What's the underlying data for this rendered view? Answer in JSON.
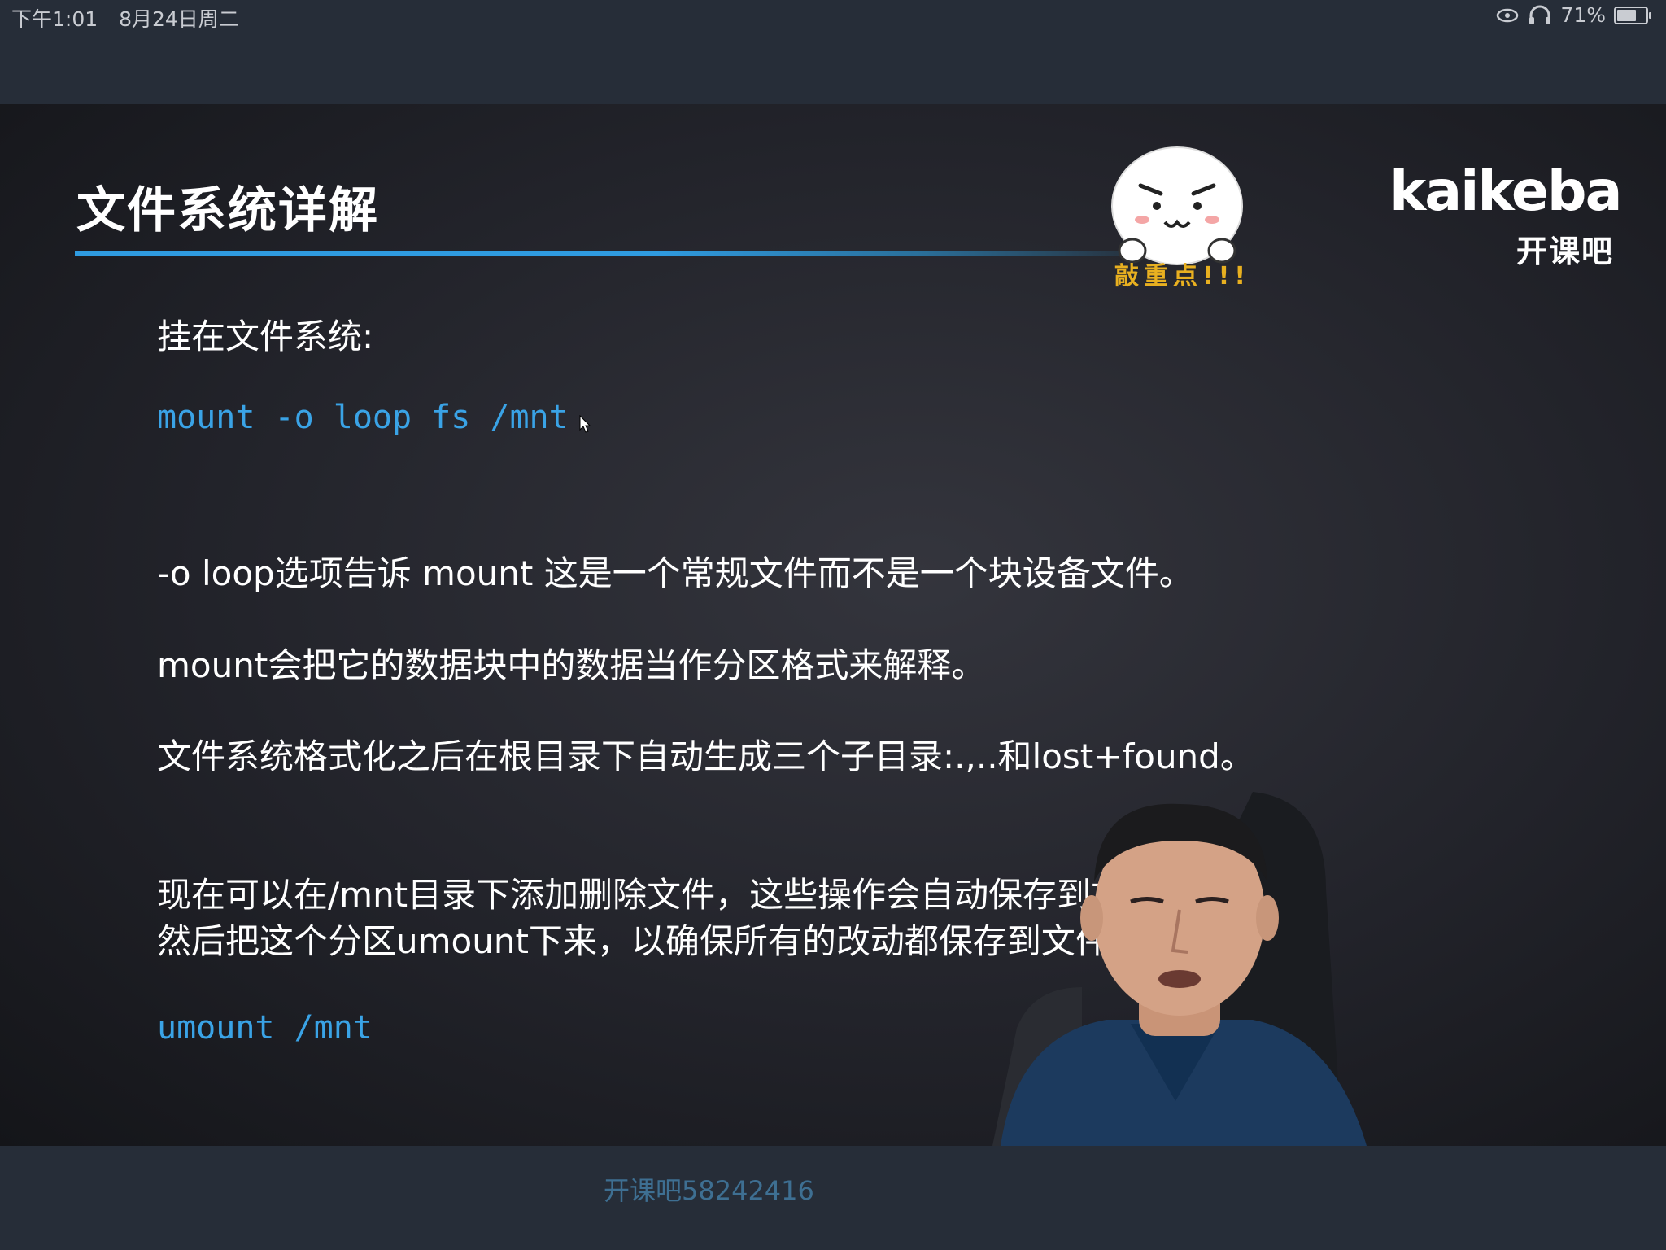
{
  "status_bar": {
    "time": "下午1:01",
    "date": "8月24日周二",
    "battery": "71%",
    "battery_level": 0.71,
    "icons": [
      "screen-mirror-icon",
      "headphones-icon",
      "battery-icon"
    ]
  },
  "slide": {
    "title": "文件系统详解",
    "sticker_caption": "敲重点!!!",
    "logo_word": "kaikeba",
    "logo_cn": "开课吧",
    "lines": [
      "挂在文件系统:",
      "mount -o loop fs /mnt",
      "-o loop选项告诉 mount 这是一个常规文件而不是一个块设备文件。",
      "mount会把它的数据块中的数据当作分区格式来解释。",
      "文件系统格式化之后在根目录下自动生成三个子目录:.,..和lost+found。",
      "现在可以在/mnt目录下添加删除文件，这些操作会自动保存到文件",
      "然后把这个分区umount下来，以确保所有的改动都保存到文件中了",
      "umount /mnt"
    ]
  },
  "bottom_bar": {
    "watermark": "开课吧58242416"
  },
  "colors": {
    "code_blue": "#3aa3e6",
    "accent_rule": "#2f9be0",
    "sticker_caption": "#e8b020",
    "watermark": "#3e6f92"
  }
}
